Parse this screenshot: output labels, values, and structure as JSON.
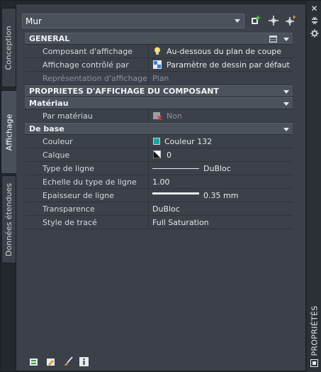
{
  "object_type": {
    "selected": "Mur"
  },
  "tabs": [
    {
      "label": "Conception"
    },
    {
      "label": "Affichage"
    },
    {
      "label": "Données étendues"
    }
  ],
  "right_strip": {
    "title": "PROPRIÉTÉS"
  },
  "sections": {
    "general": {
      "title": "GENERAL",
      "rows": [
        {
          "name": "Composant d'affichage",
          "value": "Au-dessous du plan de coupe",
          "icon": "bulb-icon"
        },
        {
          "name": "Affichage contrôlé par",
          "value": "Paramètre de dessin par défaut",
          "icon": "drawing-settings-icon"
        },
        {
          "name": "Représentation d'affichage",
          "value": "Plan"
        }
      ]
    },
    "component_props": {
      "title": "PROPRIETES D'AFFICHAGE DU COMPOSANT"
    },
    "material": {
      "title": "Matériau",
      "rows": [
        {
          "name": "Par matériau",
          "value": "Non",
          "icon": "material-icon"
        }
      ]
    },
    "basic": {
      "title": "De base",
      "rows": [
        {
          "name": "Couleur",
          "value": "Couleur 132",
          "swatch": "#1aa3a3"
        },
        {
          "name": "Calque",
          "value": "0",
          "icon": "layer-icon"
        },
        {
          "name": "Type de ligne",
          "value": "DuBloc"
        },
        {
          "name": "Echelle du type de ligne",
          "value": "1.00"
        },
        {
          "name": "Epaisseur de ligne",
          "value": "0.35 mm"
        },
        {
          "name": "Transparence",
          "value": "DuBloc"
        },
        {
          "name": "Style de tracé",
          "value": "Full Saturation"
        }
      ]
    }
  },
  "colors": {
    "panel_bg": "#3b4049",
    "category_bg": "#4c525c",
    "accent_teal": "#1aa3a3"
  }
}
